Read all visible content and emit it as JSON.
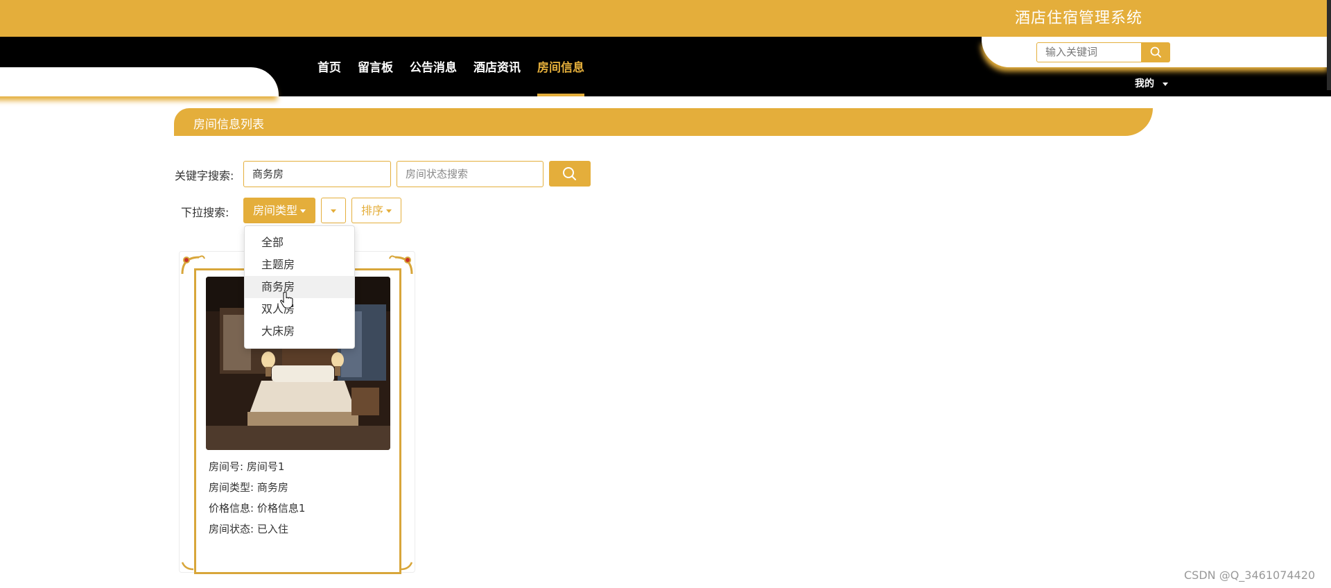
{
  "header": {
    "site_title": "酒店住宿管理系统"
  },
  "nav": {
    "items": [
      "首页",
      "留言板",
      "公告消息",
      "酒店资讯",
      "房间信息"
    ],
    "active_index": 4
  },
  "top_search": {
    "placeholder": "输入关键词"
  },
  "user_menu": {
    "label": "我的"
  },
  "page": {
    "title": "房间信息列表"
  },
  "filters": {
    "keyword_label": "关键字搜索:",
    "keyword_value": "商务房",
    "status_placeholder": "房间状态搜索",
    "dropdown_label": "下拉搜索:",
    "room_type_button": "房间类型",
    "sort_button": "排序",
    "room_type_options": [
      "全部",
      "主题房",
      "商务房",
      "双人房",
      "大床房"
    ],
    "hovered_option_index": 2
  },
  "rooms": [
    {
      "number_label": "房间号:",
      "number": "房间号1",
      "type_label": "房间类型:",
      "type": "商务房",
      "price_label": "价格信息:",
      "price": "价格信息1",
      "status_label": "房间状态:",
      "status": "已入住"
    }
  ],
  "watermark": "CSDN @Q_3461074420",
  "colors": {
    "accent": "#e4ae3b",
    "nav_bg": "#000000"
  }
}
